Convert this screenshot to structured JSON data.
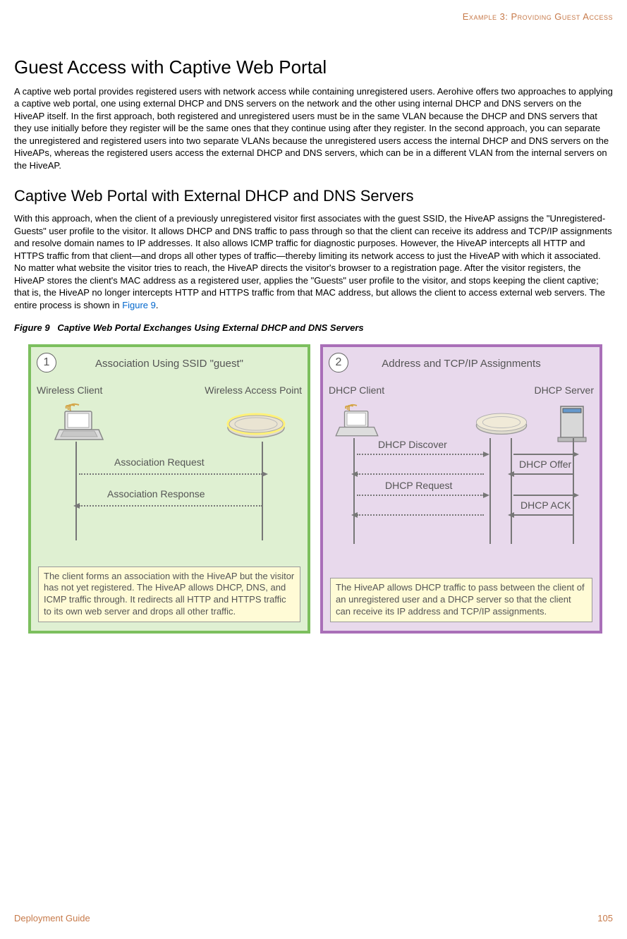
{
  "header": {
    "chapter": "Example 3: Providing Guest Access"
  },
  "h1": "Guest Access with Captive Web Portal",
  "p1": "A captive web portal provides registered users with network access while containing unregistered users. Aerohive offers two approaches to applying a captive web portal, one using external DHCP and DNS servers on the network and the other using internal DHCP and DNS servers on the HiveAP itself. In the first approach, both registered and unregistered users must be in the same VLAN because the DHCP and DNS servers that they use initially before they register will be the same ones that they continue using after they register. In the second approach, you can separate the unregistered and registered users into two separate VLANs because the unregistered users access the internal DHCP and DNS servers on the HiveAPs, whereas the registered users access the external DHCP and DNS servers, which can be in a different VLAN from the internal servers on the HiveAP.",
  "h2": "Captive Web Portal with External DHCP and DNS Servers",
  "p2a": "With this approach, when the client of a previously unregistered visitor first associates with the guest SSID, the HiveAP assigns the \"Unregistered-Guests\" user profile to the visitor. It allows DHCP and DNS traffic to pass through so that the client can receive its address and TCP/IP assignments and resolve domain names to IP addresses. It also allows ICMP traffic for diagnostic purposes. However, the HiveAP intercepts all HTTP and HTTPS traffic from that client—and drops all other types of traffic—thereby limiting its network access to just the HiveAP with which it associated. No matter what website the visitor tries to reach, the HiveAP directs the visitor's browser to a registration page. After the visitor registers, the HiveAP stores the client's MAC address as a registered user, applies the \"Guests\" user profile to the visitor, and stops keeping the client captive; that is, the HiveAP no longer intercepts HTTP and HTTPS traffic from that MAC address, but allows the client to access external web servers. The entire process is shown in ",
  "p2link": "Figure 9",
  "p2b": ".",
  "figcap_label": "Figure 9",
  "figcap_title": "Captive Web Portal Exchanges Using External DHCP and DNS Servers",
  "panel1": {
    "num": "1",
    "title": "Association Using SSID \"guest\"",
    "left_label": "Wireless Client",
    "right_label": "Wireless Access Point",
    "msg1": "Association Request",
    "msg2": "Association Response",
    "note": "The client forms an association with the HiveAP but the visitor has not yet registered. The HiveAP allows DHCP, DNS, and ICMP traffic through. It redirects all HTTP and HTTPS traffic to its own web server and drops all other traffic."
  },
  "panel2": {
    "num": "2",
    "title": "Address and TCP/IP Assignments",
    "left_label": "DHCP Client",
    "right_label": "DHCP Server",
    "msg1": "DHCP Discover",
    "msg2": "DHCP Offer",
    "msg3": "DHCP Request",
    "msg4": "DHCP ACK",
    "note": "The HiveAP allows DHCP traffic to pass between the client of an unregistered user and a DHCP server so that the client can receive its IP address and TCP/IP assignments."
  },
  "footer": {
    "left": "Deployment Guide",
    "right": "105"
  }
}
